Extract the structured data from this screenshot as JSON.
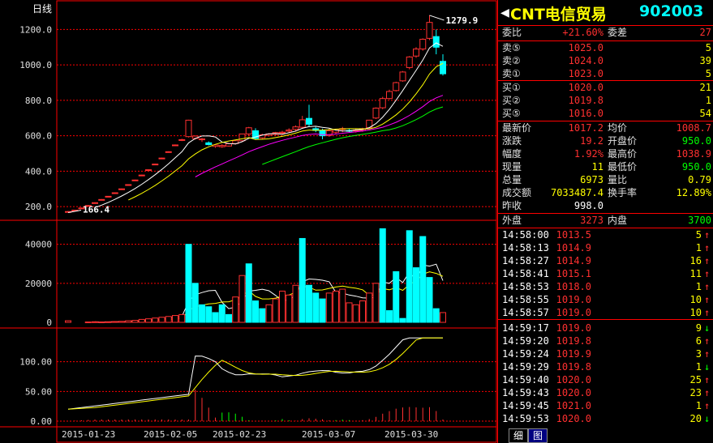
{
  "chart_data": {
    "type": "candlestick",
    "title": "日线",
    "price_ticks": [
      "1200.0",
      "1000.0",
      "800.0",
      "600.0",
      "400.0",
      "200.0"
    ],
    "price_range": [
      150,
      1330
    ],
    "high_label": "1279.9",
    "low_label": "166.4",
    "candles": [
      [
        172,
        175,
        166,
        172
      ],
      [
        178,
        182,
        176,
        180
      ],
      [
        191,
        194,
        188,
        192
      ],
      [
        205,
        208,
        202,
        206
      ],
      [
        221,
        224,
        219,
        222
      ],
      [
        239,
        242,
        236,
        240
      ],
      [
        257,
        260,
        254,
        258
      ],
      [
        277,
        280,
        274,
        278
      ],
      [
        298,
        302,
        296,
        300
      ],
      [
        322,
        326,
        320,
        324
      ],
      [
        348,
        352,
        346,
        350
      ],
      [
        375,
        380,
        372,
        378
      ],
      [
        405,
        410,
        402,
        408
      ],
      [
        438,
        442,
        435,
        440
      ],
      [
        471,
        476,
        468,
        474
      ],
      [
        508,
        512,
        504,
        510
      ],
      [
        546,
        551,
        542,
        548
      ],
      [
        577,
        583,
        570,
        578
      ],
      [
        595,
        690,
        590,
        688
      ],
      [
        585,
        602,
        578,
        598
      ],
      [
        578,
        588,
        565,
        582
      ],
      [
        560,
        568,
        545,
        550
      ],
      [
        540,
        552,
        532,
        548
      ],
      [
        538,
        552,
        532,
        545
      ],
      [
        542,
        558,
        538,
        555
      ],
      [
        556,
        575,
        550,
        572
      ],
      [
        572,
        612,
        566,
        610
      ],
      [
        610,
        650,
        598,
        645
      ],
      [
        628,
        642,
        580,
        585
      ],
      [
        588,
        612,
        582,
        605
      ],
      [
        602,
        615,
        596,
        610
      ],
      [
        608,
        622,
        600,
        618
      ],
      [
        615,
        628,
        606,
        620
      ],
      [
        626,
        642,
        616,
        632
      ],
      [
        636,
        658,
        624,
        650
      ],
      [
        648,
        712,
        640,
        690
      ],
      [
        698,
        775,
        650,
        665
      ],
      [
        640,
        650,
        620,
        630
      ],
      [
        628,
        640,
        580,
        600
      ],
      [
        602,
        640,
        594,
        628
      ],
      [
        620,
        640,
        612,
        636
      ],
      [
        636,
        650,
        620,
        640
      ],
      [
        630,
        640,
        620,
        628
      ],
      [
        627,
        642,
        618,
        632
      ],
      [
        630,
        645,
        622,
        640
      ],
      [
        645,
        690,
        640,
        688
      ],
      [
        700,
        760,
        694,
        756
      ],
      [
        758,
        820,
        750,
        810
      ],
      [
        810,
        860,
        805,
        850
      ],
      [
        855,
        905,
        850,
        900
      ],
      [
        910,
        965,
        905,
        960
      ],
      [
        985,
        1050,
        975,
        1045
      ],
      [
        1050,
        1100,
        1040,
        1090
      ],
      [
        1090,
        1150,
        1080,
        1145
      ],
      [
        1150,
        1280,
        1140,
        1240
      ],
      [
        1160,
        1200,
        1060,
        1100
      ],
      [
        1020,
        1060,
        940,
        950
      ]
    ],
    "volume_ticks": [
      "40000",
      "20000",
      "0"
    ],
    "volume_range": [
      0,
      49000
    ],
    "volume": [
      800,
      0,
      0,
      200,
      300,
      200,
      300,
      400,
      500,
      800,
      1000,
      1500,
      1800,
      2200,
      2600,
      3000,
      3500,
      4000,
      40000,
      20000,
      9000,
      8000,
      5000,
      9000,
      4000,
      13000,
      24000,
      30000,
      11000,
      7000,
      9000,
      12000,
      16000,
      14000,
      19000,
      43000,
      19000,
      15000,
      12000,
      15000,
      16000,
      17000,
      10000,
      9000,
      11000,
      15000,
      20000,
      48000,
      6000,
      26000,
      2000,
      47000,
      28000,
      44000,
      23000,
      7000,
      5000
    ],
    "volume_up": [
      true,
      true,
      true,
      true,
      true,
      true,
      true,
      true,
      true,
      true,
      true,
      true,
      true,
      true,
      true,
      true,
      true,
      true,
      false,
      false,
      false,
      false,
      false,
      false,
      false,
      true,
      true,
      false,
      false,
      false,
      true,
      true,
      true,
      true,
      true,
      false,
      false,
      false,
      false,
      true,
      true,
      true,
      true,
      true,
      true,
      true,
      true,
      false,
      false,
      false,
      false,
      false,
      false,
      false,
      false,
      false,
      true
    ],
    "indicator_ticks": [
      "100.00",
      "50.00",
      "0.00"
    ],
    "indicator_range": [
      0,
      150
    ],
    "x_labels": [
      "2015-01-23",
      "2015-02-05",
      "2015-02-23",
      "2015-03-07",
      "2015-03-30"
    ]
  },
  "panel": {
    "stock_name": "CNT电信贸易",
    "stock_code": "902003",
    "weibi_label": "委比",
    "weibi_value": "+21.60%",
    "weicha_label": "委差",
    "weicha_value": "27",
    "asks": [
      {
        "label": "卖⑤",
        "price": "1025.0",
        "vol": "5"
      },
      {
        "label": "卖②",
        "price": "1024.0",
        "vol": "39"
      },
      {
        "label": "卖①",
        "price": "1023.0",
        "vol": "5"
      }
    ],
    "bids": [
      {
        "label": "买①",
        "price": "1020.0",
        "vol": "21"
      },
      {
        "label": "买②",
        "price": "1019.8",
        "vol": "1"
      },
      {
        "label": "买⑤",
        "price": "1016.0",
        "vol": "54"
      }
    ],
    "stats": [
      {
        "l1": "最新价",
        "v1": "1017.2",
        "c1": "r",
        "l2": "均价",
        "v2": "1008.7",
        "c2": "r"
      },
      {
        "l1": "涨跌",
        "v1": "19.2",
        "c1": "r",
        "l2": "开盘价",
        "v2": "950.0",
        "c2": "g"
      },
      {
        "l1": "幅度",
        "v1": "1.92%",
        "c1": "r",
        "l2": "最高价",
        "v2": "1038.9",
        "c2": "r"
      },
      {
        "l1": "现量",
        "v1": "11",
        "c1": "y",
        "l2": "最低价",
        "v2": "950.0",
        "c2": "g"
      },
      {
        "l1": "总量",
        "v1": "6973",
        "c1": "y",
        "l2": "量比",
        "v2": "0.79",
        "c2": "y"
      },
      {
        "l1": "成交额",
        "v1": "7033487.4",
        "c1": "y",
        "l2": "换手率",
        "v2": "12.89%",
        "c2": "y"
      },
      {
        "l1": "昨收",
        "v1": "998.0",
        "c1": "w",
        "l2": "",
        "v2": "",
        "c2": "w"
      }
    ],
    "waipan_label": "外盘",
    "waipan_value": "3273",
    "neipan_label": "内盘",
    "neipan_value": "3700",
    "ticks": [
      {
        "time": "14:58:00",
        "price": "1013.5",
        "vol": "5",
        "dir": "up",
        "pc": "r",
        "vc": "y"
      },
      {
        "time": "14:58:13",
        "price": "1014.9",
        "vol": "1",
        "dir": "up",
        "pc": "r",
        "vc": "y"
      },
      {
        "time": "14:58:27",
        "price": "1014.9",
        "vol": "16",
        "dir": "up",
        "pc": "r",
        "vc": "y"
      },
      {
        "time": "14:58:41",
        "price": "1015.1",
        "vol": "11",
        "dir": "up",
        "pc": "r",
        "vc": "y"
      },
      {
        "time": "14:58:53",
        "price": "1018.0",
        "vol": "1",
        "dir": "up",
        "pc": "r",
        "vc": "y"
      },
      {
        "time": "14:58:55",
        "price": "1019.0",
        "vol": "10",
        "dir": "up",
        "pc": "r",
        "vc": "y"
      },
      {
        "time": "14:58:57",
        "price": "1019.0",
        "vol": "10",
        "dir": "up",
        "pc": "r",
        "vc": "y"
      },
      {
        "time": "14:59:17",
        "price": "1019.0",
        "vol": "9",
        "dir": "down",
        "pc": "r",
        "vc": "y"
      },
      {
        "time": "14:59:20",
        "price": "1019.8",
        "vol": "6",
        "dir": "up",
        "pc": "r",
        "vc": "y"
      },
      {
        "time": "14:59:24",
        "price": "1019.9",
        "vol": "3",
        "dir": "up",
        "pc": "r",
        "vc": "y"
      },
      {
        "time": "14:59:29",
        "price": "1019.8",
        "vol": "1",
        "dir": "down",
        "pc": "r",
        "vc": "y"
      },
      {
        "time": "14:59:40",
        "price": "1020.0",
        "vol": "25",
        "dir": "up",
        "pc": "r",
        "vc": "y"
      },
      {
        "time": "14:59:43",
        "price": "1020.0",
        "vol": "23",
        "dir": "up",
        "pc": "r",
        "vc": "y"
      },
      {
        "time": "14:59:45",
        "price": "1021.0",
        "vol": "1",
        "dir": "up",
        "pc": "r",
        "vc": "y"
      },
      {
        "time": "14:59:53",
        "price": "1020.0",
        "vol": "20",
        "dir": "down",
        "pc": "r",
        "vc": "y"
      }
    ],
    "tabs": [
      "细",
      "图"
    ],
    "up_arrow": "↑",
    "down_arrow": "↓",
    "back_arrow": "◀"
  },
  "colors": {
    "grid": "#ff0000",
    "up": "#ff3030",
    "down": "#00ffff",
    "ma1": "#ffffff",
    "ma2": "#ffff00",
    "ma3": "#ff00ff",
    "ma4": "#00ff00"
  }
}
